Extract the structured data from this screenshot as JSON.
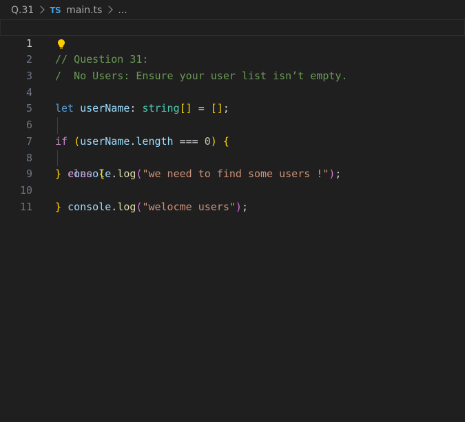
{
  "breadcrumb": {
    "folder": "Q.31",
    "file_icon": "TS",
    "file": "main.ts",
    "symbol": "..."
  },
  "editor": {
    "current_line": 1,
    "lines": [
      {
        "n": "1"
      },
      {
        "n": "2"
      },
      {
        "n": "3"
      },
      {
        "n": "4"
      },
      {
        "n": "5"
      },
      {
        "n": "6"
      },
      {
        "n": "7"
      },
      {
        "n": "8"
      },
      {
        "n": "9"
      },
      {
        "n": "10"
      },
      {
        "n": "11"
      }
    ],
    "tokens": {
      "l1_comment": "// Question 31:",
      "l2_slash": "/",
      "l2_comment": "  No Users: Ensure your user list isn’t empty.",
      "let": "let",
      "var_userName": "userName",
      "colon": ":",
      "type_string": "string",
      "brackets_type": "[]",
      "eq": "=",
      "brackets_value": "[]",
      "semi": ";",
      "if": "if",
      "paren_open": "(",
      "dot_length": ".",
      "prop_length": "length",
      "strict_eq": "===",
      "zero": "0",
      "paren_close": ")",
      "brace_open": "{",
      "console": "console",
      "dot": ".",
      "log": "log",
      "str_find": "\"we need to find some users !\"",
      "brace_close": "}",
      "else": "else",
      "str_welcome": "\"welocme users\""
    }
  },
  "colors": {
    "background": "#1f1f1f",
    "comment": "#6a9955",
    "keyword": "#569cd6",
    "control": "#c586c0",
    "variable": "#9cdcfe",
    "type": "#4ec9b0",
    "function": "#dcdcaa",
    "string": "#ce9178",
    "number": "#b5cea8",
    "bracket_level1": "#ffd700",
    "bracket_level2": "#da70d6",
    "bracket_level3": "#179fff",
    "lightbulb": "#ffcc00"
  }
}
